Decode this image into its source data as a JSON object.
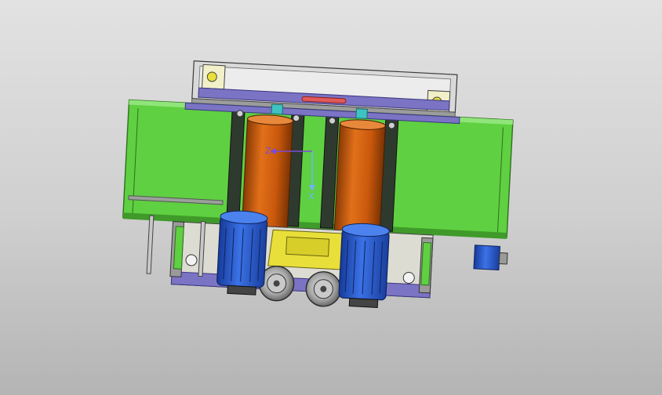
{
  "viewport": {
    "background_top": "#e2e2e2",
    "background_bottom": "#b4b4b4"
  },
  "colors": {
    "frame_green": "#5fd041",
    "frame_green_dark": "#3f9a2a",
    "drum_orange": "#cc5a0e",
    "motor_blue": "#2a5bd0",
    "rail_purple": "#7b74c4",
    "bracket_yellow": "#e8df3a",
    "accent_red": "#e15a5a",
    "accent_teal": "#3fc2c2"
  },
  "triad": {
    "axis_z": "Z",
    "axis_x": "X",
    "z_icon": "axis-z-arrow-icon",
    "x_icon": "axis-x-arrow-icon"
  }
}
